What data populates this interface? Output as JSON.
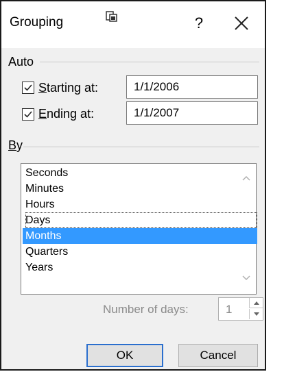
{
  "dialog": {
    "title": "Grouping",
    "help_label": "?",
    "icons": {
      "restore": "restore-window-icon",
      "close": "close-icon"
    }
  },
  "auto": {
    "label": "Auto",
    "starting": {
      "label_mnemonic": "S",
      "label_rest": "tarting at:",
      "checked": true,
      "value": "1/1/2006"
    },
    "ending": {
      "label_mnemonic": "E",
      "label_rest": "nding at:",
      "checked": true,
      "value": "1/1/2007"
    }
  },
  "by": {
    "label_mnemonic": "B",
    "label_rest": "y",
    "items": [
      "Seconds",
      "Minutes",
      "Hours",
      "Days",
      "Months",
      "Quarters",
      "Years"
    ],
    "focused_item": "Days",
    "selected_item": "Months"
  },
  "number_of_days": {
    "label": "Number of days:",
    "value": "1",
    "enabled": false
  },
  "buttons": {
    "ok": "OK",
    "cancel": "Cancel"
  },
  "colors": {
    "selection": "#3399ff",
    "default_button_border": "#2b6fce",
    "dialog_background": "#f0f0f0"
  }
}
